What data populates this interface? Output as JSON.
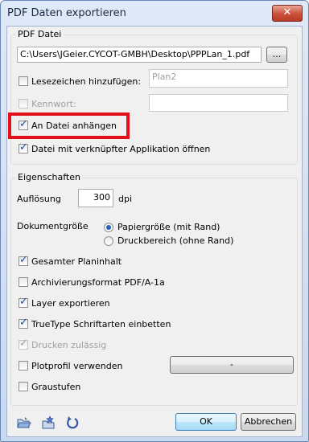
{
  "window": {
    "title": "PDF Daten exportieren",
    "close_glyph": "✕"
  },
  "pdf_file": {
    "group_label": "PDF Datei",
    "path": "C:\\Users\\JGeier.CYCOT-GMBH\\Desktop\\PPPLan_1.pdf",
    "browse_label": "...",
    "bookmark_label": "Lesezeichen hinzufügen:",
    "bookmark_checked": false,
    "bookmark_value": "Plan2",
    "password_label": "Kennwort:",
    "password_checked": false,
    "password_value": "",
    "attach_label": "An Datei anhängen",
    "attach_checked": true,
    "open_label": "Datei mit verknüpfter Applikation öffnen",
    "open_checked": true
  },
  "properties": {
    "group_label": "Eigenschaften",
    "resolution_label": "Auflösung",
    "resolution_value": "300",
    "resolution_unit": "dpi",
    "docsize_label": "Dokumentgröße",
    "docsize_options": [
      "Papiergröße (mit Rand)",
      "Druckbereich (ohne Rand)"
    ],
    "docsize_selected": "Papiergröße (mit Rand)",
    "total_plan_label": "Gesamter Planinhalt",
    "archive_label": "Archivierungsformat PDF/A-1a",
    "layer_label": "Layer exportieren",
    "truetype_label": "TrueType Schriftarten einbetten",
    "print_label": "Drucken zulässig",
    "plotprofile_label": "Plotprofil verwenden",
    "plotprofile_button": "-",
    "grayscale_label": "Graustufen",
    "checks": {
      "total_plan": true,
      "archive": false,
      "layer": true,
      "truetype": true,
      "print": true,
      "plotprofile": false,
      "grayscale": false
    }
  },
  "footer": {
    "icons": [
      "open-folder-icon",
      "favorite-star-icon",
      "reset-icon"
    ],
    "ok_label": "OK",
    "cancel_label": "Abbrechen"
  },
  "colors": {
    "highlight": "#e3101c",
    "accent": "#2a62b8"
  }
}
